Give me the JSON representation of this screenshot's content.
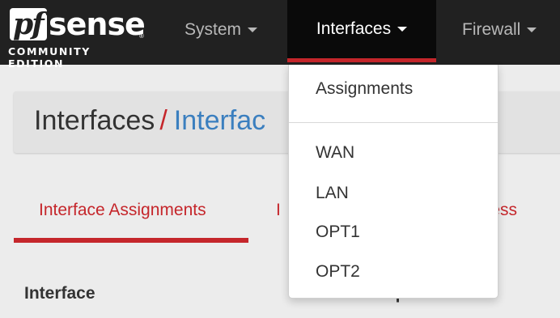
{
  "brand": {
    "logo_mark": "pf",
    "logo_word": "sense",
    "registered": "®",
    "edition": "COMMUNITY EDITION"
  },
  "navbar": {
    "items": [
      {
        "label": "System"
      },
      {
        "label": "Interfaces",
        "active": true
      },
      {
        "label": "Firewall"
      }
    ]
  },
  "breadcrumb": {
    "parent": "Interfaces",
    "separator": "/",
    "current": "Interfac"
  },
  "tabs": [
    {
      "label": "Interface Assignments",
      "active": true
    },
    {
      "label": "I"
    },
    {
      "label": "eless"
    }
  ],
  "table": {
    "headers": [
      "Interface",
      "Network port"
    ]
  },
  "dropdown": {
    "items": [
      "Assignments",
      "WAN",
      "LAN",
      "OPT1",
      "OPT2"
    ]
  },
  "colors": {
    "navbar_bg": "#212121",
    "accent_red": "#c5262b",
    "link_blue": "#3b7fbf"
  }
}
